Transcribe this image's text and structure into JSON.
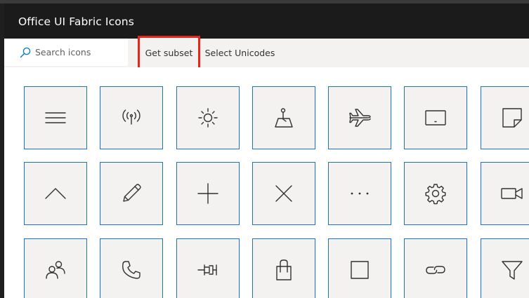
{
  "app": {
    "title": "Office UI Fabric Icons"
  },
  "toolbar": {
    "search_placeholder": "Search icons",
    "get_subset_label": "Get subset",
    "select_unicodes_label": "Select Unicodes",
    "highlight_color": "#e3281b"
  },
  "icons": {
    "row1": [
      "hamburger-menu-icon",
      "antenna-signal-icon",
      "sun-brightness-icon",
      "map-pin-icon",
      "airplane-icon",
      "tablet-icon",
      "sticky-note-icon"
    ],
    "row2": [
      "chevron-up-icon",
      "pencil-edit-icon",
      "plus-icon",
      "close-x-icon",
      "more-ellipsis-icon",
      "settings-gear-icon",
      "video-camera-icon"
    ],
    "row3": [
      "people-icon",
      "phone-icon",
      "pin-icon",
      "shopping-bag-icon",
      "checkbox-square-icon",
      "link-icon",
      "filter-icon"
    ]
  },
  "colors": {
    "tile_border": "#1a73c8",
    "tile_bg": "#f3f2f1",
    "titlebar_bg": "#1b1b1b"
  }
}
